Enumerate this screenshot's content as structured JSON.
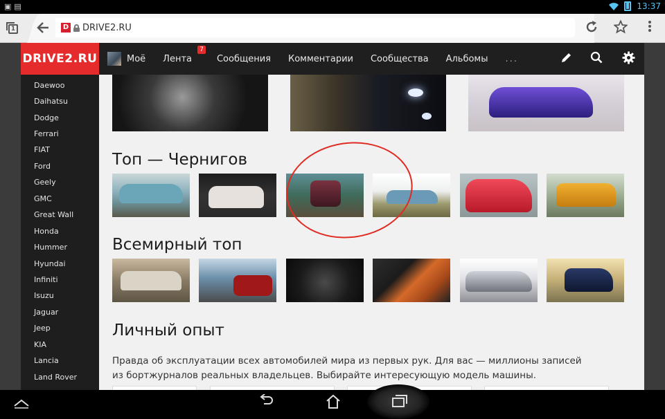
{
  "status_bar": {
    "time": "13:37"
  },
  "browser": {
    "tab_count": "1",
    "favicon_letter": "D",
    "url": "DRIVE2.RU"
  },
  "site": {
    "logo": "DRIVE2.RU",
    "nav": [
      {
        "label": "Моё"
      },
      {
        "label": "Лента",
        "badge": "7"
      },
      {
        "label": "Сообщения"
      },
      {
        "label": "Комментарии"
      },
      {
        "label": "Сообщества"
      },
      {
        "label": "Альбомы"
      }
    ],
    "nav_more": "...",
    "sidebar": [
      "Daewoo",
      "Daihatsu",
      "Dodge",
      "Ferrari",
      "FIAT",
      "Ford",
      "Geely",
      "GMC",
      "Great Wall",
      "Honda",
      "Hummer",
      "Hyundai",
      "Infiniti",
      "Isuzu",
      "Jaguar",
      "Jeep",
      "KIA",
      "Lancia",
      "Land Rover"
    ]
  },
  "content": {
    "section_top_city": "Топ — Чернигов",
    "section_world_top": "Всемирный топ",
    "section_experience": "Личный опыт",
    "experience_text": "Правда об эксплуатации всех автомобилей мира из первых рук. Для вас — миллионы записей из бортжурналов реальных владельцев. Выбирайте интересующую модель машины."
  },
  "colors": {
    "brand_red": "#e52b2b",
    "header_dark": "#1f1f1f",
    "annotation_red": "#e02a22"
  }
}
